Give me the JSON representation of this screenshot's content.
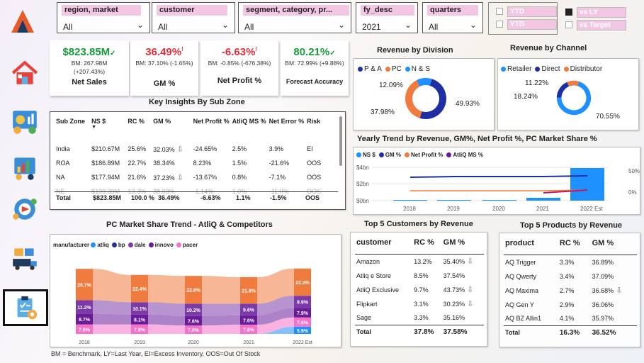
{
  "filters": {
    "region": {
      "label": "region, market",
      "value": "All"
    },
    "customer": {
      "label": "customer",
      "value": "All"
    },
    "segment": {
      "label": "segment, category, pr...",
      "value": "All"
    },
    "fy": {
      "label": "fy_desc",
      "value": "2021"
    },
    "quarters": {
      "label": "quarters",
      "value": "All"
    }
  },
  "toggles": {
    "ytd": "YTD",
    "ytg": "YTG",
    "vs_ly": "vs LY",
    "vs_target": "vs Target"
  },
  "kpis": {
    "net_sales": {
      "value": "$823.85M",
      "check": "✓",
      "bm": "BM: 267.98M",
      "change": "(+207.43%)",
      "label": "Net Sales",
      "color": "#1a9a3a"
    },
    "gm": {
      "value": "36.49%",
      "mark": "!",
      "bm": "BM: 37.10% (-1.65%)",
      "label": "GM %",
      "color": "#e0303a"
    },
    "net_profit": {
      "value": "-6.63%",
      "mark": "!",
      "bm": "BM: -0.85% (-676.38%)",
      "label": "Net Profit %",
      "color": "#e0303a"
    },
    "forecast": {
      "value": "80.21%",
      "check": "✓",
      "bm": "BM: 72.99% (+9.88%)",
      "label": "Forecast Accuracy",
      "color": "#1a9a3a"
    }
  },
  "sub_zone": {
    "title": "Key Insights By Sub Zone",
    "headers": [
      "Sub Zone",
      "NS $",
      "RC %",
      "GM %",
      "Net Profit %",
      "AtliQ MS %",
      "Net Error %",
      "Risk"
    ],
    "sort_arrow": "▼",
    "rows": [
      [
        "India",
        "$210.67M",
        "25.6%",
        "32.03%",
        "-24.65%",
        "2.5%",
        "3.9%",
        "EI"
      ],
      [
        "ROA",
        "$186.89M",
        "22.7%",
        "38.34%",
        "8.23%",
        "1.5%",
        "-21.6%",
        "OOS"
      ],
      [
        "NA",
        "$177.94M",
        "21.6%",
        "37.23%",
        "-13.67%",
        "0.8%",
        "-7.1%",
        "OOS"
      ],
      [
        "NE",
        "$109.39M",
        "13.3%",
        "38.03%",
        "-1.14%",
        "1.0%",
        "-11.0%",
        "OOS"
      ]
    ],
    "down_rows": [
      0,
      2
    ],
    "total": [
      "Total",
      "$823.85M",
      "100.0 %",
      "36.49%",
      "-6.63%",
      "1.1%",
      "-1.5%",
      "OOS"
    ]
  },
  "division": {
    "title": "Revenue by Division",
    "legend": [
      "P & A",
      "PC",
      "N & S"
    ],
    "labels": [
      "49.93%",
      "37.98%",
      "12.09%"
    ],
    "colors": [
      "#1f2fa3",
      "#f07b3f",
      "#1e90ff"
    ],
    "values": [
      49.93,
      37.98,
      12.09
    ]
  },
  "channel": {
    "title": "Revenue by Channel",
    "legend": [
      "Retailer",
      "Direct",
      "Distributor"
    ],
    "labels": [
      "70.55%",
      "18.24%",
      "11.22%"
    ],
    "colors": [
      "#1e90ff",
      "#1f2fa3",
      "#f07b3f"
    ],
    "values": [
      70.55,
      18.24,
      11.22
    ]
  },
  "yearly": {
    "title": "Yearly Trend by Revenue, GM%, Net Profit %, PC Market Share %",
    "legend": [
      "NS $",
      "GM %",
      "Net Profit %",
      "AtliQ MS %"
    ],
    "colors": [
      "#1e90ff",
      "#1f2fa3",
      "#f07b3f",
      "#6a1b9a"
    ],
    "y_left_ticks": [
      "$4bn",
      "$2bn",
      "$0bn"
    ],
    "y_right_ticks": [
      "50%",
      "0%"
    ],
    "years": [
      "2018",
      "2019",
      "2020",
      "2021",
      "2022 Est"
    ]
  },
  "chart_data": {
    "type": "area",
    "title": "PC Market Share Trend - AtliQ & Competitors",
    "legend_title": "manufacturer",
    "categories": [
      "2018",
      "2019",
      "2020",
      "2021",
      "2022 Est"
    ],
    "series": [
      {
        "name": "atliq",
        "color": "#1e90ff",
        "values": [
          null,
          null,
          null,
          null,
          5.9
        ],
        "labels": [
          "",
          "",
          "",
          "",
          "5.9%"
        ]
      },
      {
        "name": "pacer",
        "color": "#f472c8",
        "values": [
          7.8,
          7.8,
          7.0,
          7.6,
          7.6
        ],
        "labels": [
          "7.8%",
          "7.8%",
          "7.0%",
          "7.6%",
          "7.6%"
        ]
      },
      {
        "name": "innovo",
        "color": "#6a1b9a",
        "values": [
          8.7,
          8.1,
          7.6,
          7.6,
          7.9
        ],
        "labels": [
          "8.7%",
          "8.1%",
          "7.6%",
          "7.6%",
          "7.9%"
        ]
      },
      {
        "name": "dale",
        "color": "#7b3aa8",
        "values": [
          11.2,
          10.1,
          10.2,
          9.6,
          9.9
        ],
        "labels": [
          "11.2%",
          "10.1%",
          "10.2%",
          "9.6%",
          "9.9%"
        ]
      },
      {
        "name": "bp",
        "color": "#1f2fa3",
        "values": [
          null,
          null,
          null,
          null,
          null
        ],
        "labels": [
          "",
          "",
          "",
          "",
          ""
        ]
      },
      {
        "name": "other",
        "color": "#f07b3f",
        "values": [
          25.7,
          22.4,
          22.8,
          21.8,
          22.3
        ],
        "labels": [
          "25.7%",
          "22.4%",
          "22.8%",
          "21.8%",
          "22.3%"
        ]
      }
    ]
  },
  "customers": {
    "title": "Top 5 Customers by Revenue",
    "headers": [
      "customer",
      "RC %",
      "GM %"
    ],
    "rows": [
      [
        "Amazon",
        "13.2%",
        "35.40%",
        true
      ],
      [
        "Atliq e Store",
        "8.5%",
        "37.54%",
        false
      ],
      [
        "AtliQ Exclusive",
        "9.7%",
        "43.73%",
        true
      ],
      [
        "Flipkart",
        "3.1%",
        "30.23%",
        true
      ],
      [
        "Sage",
        "3.3%",
        "35.16%",
        false
      ]
    ],
    "total": [
      "Total",
      "37.8%",
      "37.58%"
    ]
  },
  "products": {
    "title": "Top 5 Products by Revenue",
    "headers": [
      "product",
      "RC %",
      "GM %"
    ],
    "rows": [
      [
        "AQ Trigger",
        "3.3%",
        "36.89%",
        false
      ],
      [
        "AQ Qwerty",
        "3.4%",
        "37.09%",
        false
      ],
      [
        "AQ Maxima",
        "2.7%",
        "36.68%",
        true
      ],
      [
        "AQ Gen Y",
        "2.9%",
        "36.06%",
        false
      ],
      [
        "AQ BZ Allin1",
        "4.1%",
        "35.97%",
        false
      ]
    ],
    "total": [
      "Total",
      "16.3%",
      "36.52%"
    ]
  },
  "footer": "BM = Benchmark, LY=Last Year, EI=Excess Inventory, OOS=Out Of Stock"
}
